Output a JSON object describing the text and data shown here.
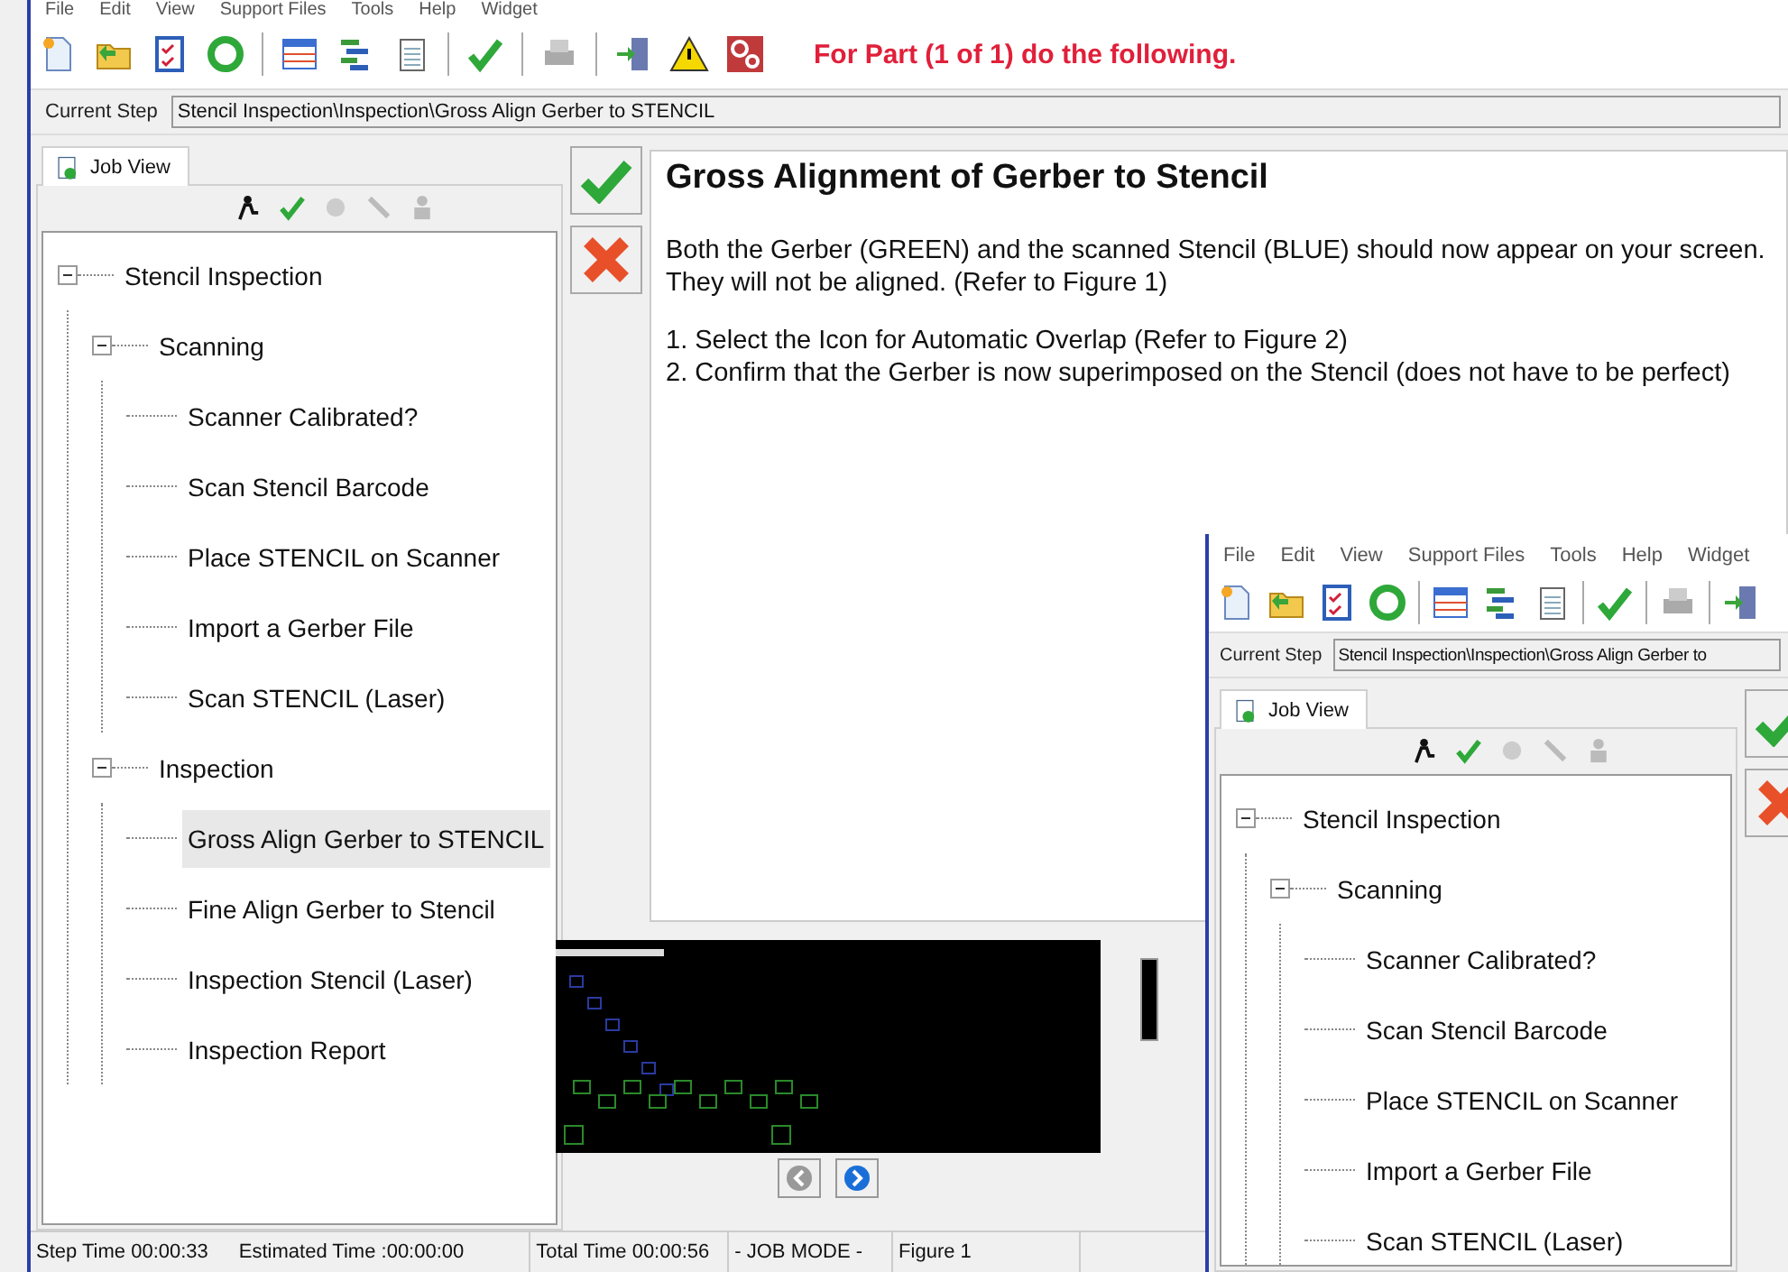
{
  "menu": [
    "File",
    "Edit",
    "View",
    "Support Files",
    "Tools",
    "Help",
    "Widget"
  ],
  "part_message": "For Part  (1 of 1) do the following.",
  "current_step": {
    "label": "Current Step",
    "value": "Stencil Inspection\\Inspection\\Gross Align Gerber to STENCIL"
  },
  "tabs": [
    {
      "label": "Job View",
      "selected": true
    }
  ],
  "tree": [
    {
      "label": "Stencil Inspection",
      "expanded": true,
      "selected": false,
      "children": [
        {
          "label": "Scanning",
          "expanded": true,
          "selected": false,
          "children": [
            {
              "label": "Scanner Calibrated?",
              "selected": false
            },
            {
              "label": "Scan Stencil Barcode",
              "selected": false
            },
            {
              "label": "Place STENCIL on Scanner",
              "selected": false
            },
            {
              "label": "Import a Gerber File",
              "selected": false
            },
            {
              "label": "Scan STENCIL (Laser)",
              "selected": false
            }
          ]
        },
        {
          "label": "Inspection",
          "expanded": true,
          "selected": false,
          "children": [
            {
              "label": "Gross Align Gerber to STENCIL",
              "selected": true
            },
            {
              "label": "Fine Align Gerber to Stencil",
              "selected": false
            },
            {
              "label": "Inspection Stencil (Laser)",
              "selected": false
            },
            {
              "label": "Inspection Report",
              "selected": false
            }
          ]
        }
      ]
    }
  ],
  "instruction": {
    "title": "Gross Alignment of Gerber to Stencil",
    "paragraphs": [
      "Both the Gerber (GREEN) and the scanned Stencil (BLUE) should now appear on your screen. They will not be aligned. (Refer to Figure 1)",
      "1. Select the Icon for Automatic Overlap (Refer to Figure 2)\n2. Confirm that the Gerber is now superimposed on the Stencil (does not have to be perfect)"
    ]
  },
  "figure_nav": {
    "previous_disabled": true,
    "next_disabled": false
  },
  "status_bar": [
    "Step Time 00:00:33",
    "Estimated Time :00:00:00",
    "Total Time 00:00:56",
    "- JOB MODE -",
    "Figure 1"
  ],
  "inset": {
    "menu": [
      "File",
      "Edit",
      "View",
      "Support Files",
      "Tools",
      "Help",
      "Widget"
    ],
    "current_step": {
      "label": "Current Step",
      "value": "Stencil Inspection\\Inspection\\Gross Align Gerber to"
    },
    "tabs": [
      {
        "label": "Job View",
        "selected": true
      }
    ],
    "tree": [
      {
        "label": "Stencil Inspection",
        "expanded": true,
        "selected": false,
        "children": [
          {
            "label": "Scanning",
            "expanded": true,
            "selected": false,
            "children": [
              {
                "label": "Scanner Calibrated?",
                "selected": false
              },
              {
                "label": "Scan Stencil Barcode",
                "selected": false
              },
              {
                "label": "Place STENCIL on Scanner",
                "selected": false
              },
              {
                "label": "Import a Gerber File",
                "selected": false
              },
              {
                "label": "Scan STENCIL (Laser)",
                "selected": false
              }
            ]
          }
        ]
      }
    ]
  }
}
